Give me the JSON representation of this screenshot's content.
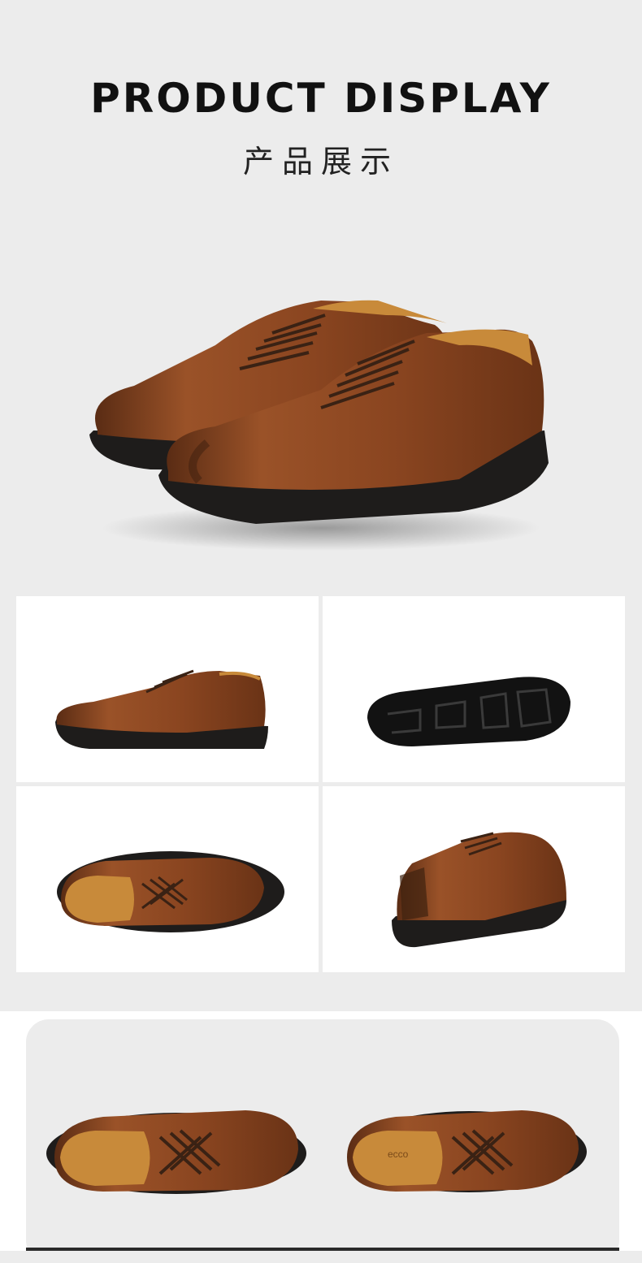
{
  "header": {
    "title": "PRODUCT DISPLAY",
    "subtitle": "产品展示"
  },
  "images": {
    "hero": "pair-of-brown-derby-shoes",
    "grid": [
      "side-view-shoe",
      "sole-view",
      "top-view-shoe",
      "rear-three-quarter-view"
    ],
    "bottom": [
      "top-view-shoe-left",
      "top-view-shoe-right"
    ]
  },
  "insole_logo": "ecco",
  "colors": {
    "background": "#ececec",
    "leather": "#8b4a23",
    "sole": "#1e1c1b",
    "lining": "#c88a3a"
  }
}
